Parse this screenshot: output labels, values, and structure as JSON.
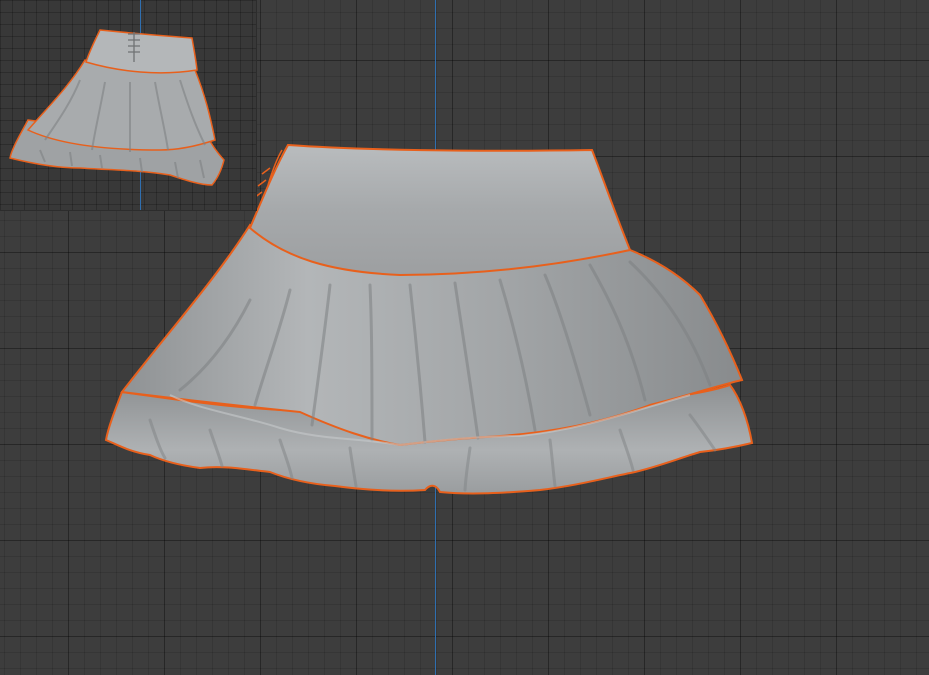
{
  "viewport": {
    "object": "skirt",
    "selection_outline_color": "#e8601c",
    "mesh_color": "#a9acae",
    "grid_color": "#3d3d3d",
    "axis_color": "#2f6fb0"
  },
  "camera_preview": {
    "object": "skirt"
  }
}
